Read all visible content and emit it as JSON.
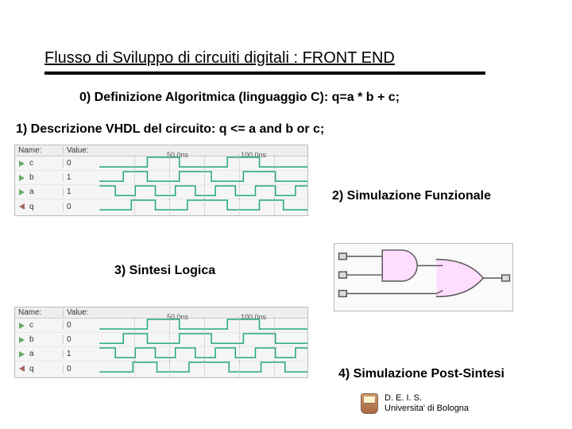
{
  "title": "Flusso di Sviluppo di circuiti digitali : FRONT END",
  "steps": {
    "s0": "0) Definizione Algoritmica (linguaggio C):  q=a * b + c;",
    "s1": "1)  Descrizione VHDL del circuito:  q <= a and b or c;",
    "s2": "2) Simulazione Funzionale",
    "s3": "3) Sintesi Logica",
    "s4": "4) Simulazione Post-Sintesi"
  },
  "wave_header": {
    "name": "Name:",
    "value": "Value:",
    "t1": "50.0ns",
    "t2": "100.0ns"
  },
  "wave2_header": {
    "t1": "50.0ns",
    "t2": "100.0ns"
  },
  "signals1": [
    {
      "pin": "in",
      "name": "c",
      "value": "0"
    },
    {
      "pin": "in",
      "name": "b",
      "value": "1"
    },
    {
      "pin": "in",
      "name": "a",
      "value": "1"
    },
    {
      "pin": "out",
      "name": "q",
      "value": "0"
    }
  ],
  "signals2": [
    {
      "pin": "in",
      "name": "c",
      "value": "0"
    },
    {
      "pin": "in",
      "name": "b",
      "value": "0"
    },
    {
      "pin": "in",
      "name": "a",
      "value": "1"
    },
    {
      "pin": "out",
      "name": "q",
      "value": "0"
    }
  ],
  "footer": {
    "org": "D. E. I. S.",
    "inst": "Universita' di Bologna"
  }
}
